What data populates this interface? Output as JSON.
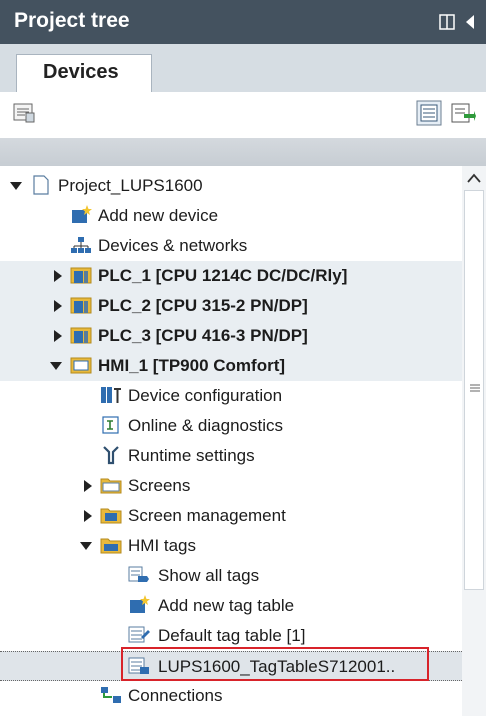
{
  "panel": {
    "title": "Project tree"
  },
  "tabs": [
    {
      "label": "Devices"
    }
  ],
  "tree": {
    "items": [
      {
        "label": "Project_LUPS1600",
        "icon": "project-icon"
      },
      {
        "label": "Add new device",
        "icon": "add-device-icon"
      },
      {
        "label": "Devices & networks",
        "icon": "network-icon"
      },
      {
        "label": "PLC_1 [CPU 1214C DC/DC/Rly]",
        "icon": "plc-icon"
      },
      {
        "label": "PLC_2 [CPU 315-2 PN/DP]",
        "icon": "plc-icon"
      },
      {
        "label": "PLC_3 [CPU 416-3 PN/DP]",
        "icon": "plc-icon"
      },
      {
        "label": "HMI_1 [TP900 Comfort]",
        "icon": "hmi-icon"
      },
      {
        "label": "Device configuration",
        "icon": "device-config-icon"
      },
      {
        "label": "Online & diagnostics",
        "icon": "diagnostics-icon"
      },
      {
        "label": "Runtime settings",
        "icon": "runtime-icon"
      },
      {
        "label": "Screens",
        "icon": "folder-icon"
      },
      {
        "label": "Screen management",
        "icon": "screen-management-icon"
      },
      {
        "label": "HMI tags",
        "icon": "folder-open-icon"
      },
      {
        "label": "Show all tags",
        "icon": "tags-icon"
      },
      {
        "label": "Add new tag table",
        "icon": "add-tag-table-icon"
      },
      {
        "label": "Default tag table [1]",
        "icon": "tag-table-icon"
      },
      {
        "label": "LUPS1600_TagTableS712001..",
        "icon": "tag-table-icon"
      },
      {
        "label": "Connections",
        "icon": "connections-icon"
      }
    ]
  },
  "colors": {
    "header_bg": "#44525f",
    "highlight_border": "#d8232a",
    "folder": "#e8b93c"
  }
}
